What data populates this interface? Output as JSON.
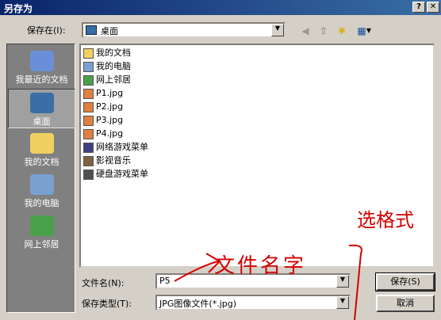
{
  "window": {
    "title": "另存为",
    "help_btn": "?",
    "close_btn": "✕"
  },
  "savein": {
    "label": "保存在(I):",
    "value": "桌面"
  },
  "toolbar": {
    "back": "◀",
    "up": "⇧",
    "newfolder": "✱",
    "views": "▦"
  },
  "places": [
    {
      "label": "我最近的文档",
      "icon": "recent-documents-icon",
      "color": "#6a8fd8"
    },
    {
      "label": "桌面",
      "icon": "desktop-icon",
      "color": "#3a6ea5"
    },
    {
      "label": "我的文档",
      "icon": "my-documents-icon",
      "color": "#f0d060"
    },
    {
      "label": "我的电脑",
      "icon": "my-computer-icon",
      "color": "#7aa0d0"
    },
    {
      "label": "网上邻居",
      "icon": "network-icon",
      "color": "#4aa04a"
    }
  ],
  "files": [
    {
      "name": "我的文档",
      "icon": "folder-icon",
      "color": "#f0d060"
    },
    {
      "name": "我的电脑",
      "icon": "computer-icon",
      "color": "#7aa0d0"
    },
    {
      "name": "网上邻居",
      "icon": "network-icon",
      "color": "#4aa04a"
    },
    {
      "name": "P1.jpg",
      "icon": "image-file-icon",
      "color": "#e08040"
    },
    {
      "name": "P2.jpg",
      "icon": "image-file-icon",
      "color": "#e08040"
    },
    {
      "name": "P3.jpg",
      "icon": "image-file-icon",
      "color": "#e08040"
    },
    {
      "name": "P4.jpg",
      "icon": "image-file-icon",
      "color": "#e08040"
    },
    {
      "name": "网络游戏菜单",
      "icon": "shortcut-icon",
      "color": "#404080"
    },
    {
      "name": "影视音乐",
      "icon": "shortcut-icon",
      "color": "#806040"
    },
    {
      "name": "硬盘游戏菜单",
      "icon": "shortcut-icon",
      "color": "#505050"
    }
  ],
  "filename": {
    "label": "文件名(N):",
    "value": "P5"
  },
  "filetype": {
    "label": "保存类型(T):",
    "value": "JPG图像文件(*.jpg)"
  },
  "buttons": {
    "save": "保存(S)",
    "cancel": "取消"
  },
  "annotations": {
    "format": "选格式",
    "name": "文件名字"
  }
}
